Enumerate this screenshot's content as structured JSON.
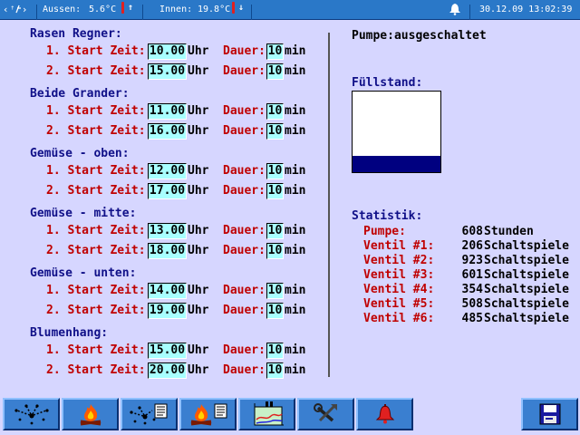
{
  "status_bar": {
    "outside_label": "Aussen:",
    "outside_temp": "5.6°C",
    "inside_label": "Innen:",
    "inside_temp": "19.8°C",
    "datetime": "30.12.09 13:02:39"
  },
  "labels": {
    "start_1": "1. Start Zeit:",
    "start_2": "2. Start Zeit:",
    "unit_time": "Uhr",
    "duration": "Dauer:",
    "unit_min": "min"
  },
  "zones": [
    {
      "name": "Rasen Regner:",
      "starts": [
        {
          "time": "10.00",
          "duration": "10"
        },
        {
          "time": "15.00",
          "duration": "10"
        }
      ]
    },
    {
      "name": "Beide Grander:",
      "starts": [
        {
          "time": "11.00",
          "duration": "10"
        },
        {
          "time": "16.00",
          "duration": "10"
        }
      ]
    },
    {
      "name": "Gemüse - oben:",
      "starts": [
        {
          "time": "12.00",
          "duration": "10"
        },
        {
          "time": "17.00",
          "duration": "10"
        }
      ]
    },
    {
      "name": "Gemüse - mitte:",
      "starts": [
        {
          "time": "13.00",
          "duration": "10"
        },
        {
          "time": "18.00",
          "duration": "10"
        }
      ]
    },
    {
      "name": "Gemüse - unten:",
      "starts": [
        {
          "time": "14.00",
          "duration": "10"
        },
        {
          "time": "19.00",
          "duration": "10"
        }
      ]
    },
    {
      "name": "Blumenhang:",
      "starts": [
        {
          "time": "15.00",
          "duration": "10"
        },
        {
          "time": "20.00",
          "duration": "10"
        }
      ]
    }
  ],
  "pump": {
    "label": "Pumpe:",
    "status": "ausgeschaltet"
  },
  "fill_level": {
    "label": "Füllstand:",
    "level_fraction": 0.2
  },
  "statistics": {
    "title": "Statistik:",
    "rows": [
      {
        "label": "Pumpe:",
        "value": "608",
        "unit": "Stunden"
      },
      {
        "label": "Ventil #1:",
        "value": "206",
        "unit": "Schaltspiele"
      },
      {
        "label": "Ventil #2:",
        "value": "923",
        "unit": "Schaltspiele"
      },
      {
        "label": "Ventil #3:",
        "value": "601",
        "unit": "Schaltspiele"
      },
      {
        "label": "Ventil #4:",
        "value": "354",
        "unit": "Schaltspiele"
      },
      {
        "label": "Ventil #5:",
        "value": "508",
        "unit": "Schaltspiele"
      },
      {
        "label": "Ventil #6:",
        "value": "485",
        "unit": "Schaltspiele"
      }
    ]
  },
  "toolbar": [
    {
      "icon": "sprinkler-icon"
    },
    {
      "icon": "fire-icon"
    },
    {
      "icon": "sprinkler-schedule-icon"
    },
    {
      "icon": "fire-schedule-icon"
    },
    {
      "icon": "chart-icon"
    },
    {
      "icon": "tools-icon"
    },
    {
      "icon": "bell-icon"
    },
    {
      "icon": "save-icon"
    }
  ],
  "colors": {
    "background": "#d6d6ff",
    "title": "#101088",
    "label": "#c00000",
    "field": "#a8ffff",
    "bar": "#2a78c8"
  }
}
